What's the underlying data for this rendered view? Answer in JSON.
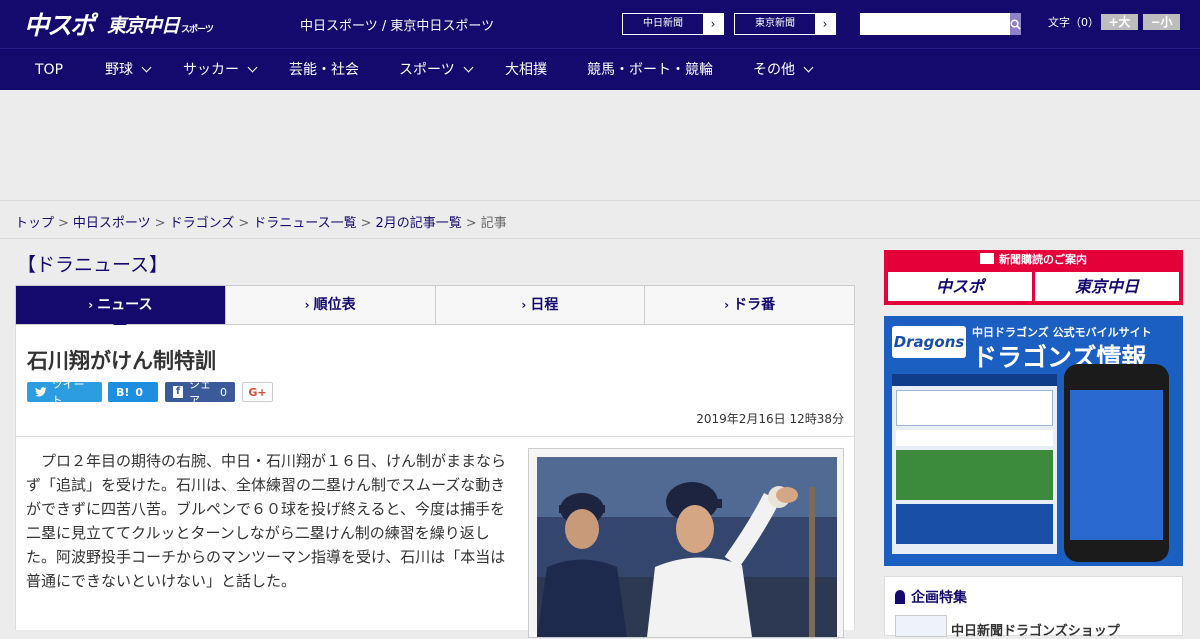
{
  "header": {
    "logo_main": "中スポ",
    "logo_tokyo": "東京中日",
    "logo_tokyo_suffix": "スポーツ",
    "site_title": "中日スポーツ / 東京中日スポーツ",
    "links": [
      {
        "label": "中日新聞"
      },
      {
        "label": "東京新聞"
      }
    ],
    "search_placeholder": "",
    "font_size_label": "文字（0）",
    "font_bigger": "+大",
    "font_smaller": "−小"
  },
  "nav": {
    "items": [
      {
        "label": "TOP",
        "has_menu": false
      },
      {
        "label": "野球",
        "has_menu": true
      },
      {
        "label": "サッカー",
        "has_menu": true
      },
      {
        "label": "芸能・社会",
        "has_menu": false
      },
      {
        "label": "スポーツ",
        "has_menu": true
      },
      {
        "label": "大相撲",
        "has_menu": false
      },
      {
        "label": "競馬・ボート・競輪",
        "has_menu": false
      },
      {
        "label": "その他",
        "has_menu": true
      }
    ]
  },
  "breadcrumb": {
    "items": [
      "トップ",
      "中日スポーツ",
      "ドラゴンズ",
      "ドラニュース一覧",
      "2月の記事一覧"
    ],
    "current": "記事",
    "separator": ">"
  },
  "section": {
    "title": "【ドラニュース】"
  },
  "tabs": [
    {
      "label": "ニュース",
      "active": true
    },
    {
      "label": "順位表",
      "active": false
    },
    {
      "label": "日程",
      "active": false
    },
    {
      "label": "ドラ番",
      "active": false
    }
  ],
  "article": {
    "headline": "石川翔がけん制特訓",
    "share": {
      "tweet": "ツイート",
      "hatena_count": "0",
      "facebook": "シェア",
      "facebook_count": "0",
      "gplus": "G+"
    },
    "date": "2019年2月16日 12時38分",
    "body": "プロ２年目の期待の右腕、中日・石川翔が１６日、けん制がままならず「追試」を受けた。石川は、全体練習の二塁けん制でスムーズな動きができずに四苦八苦。ブルペンで６０球を投げ終えると、今度は捕手を二塁に見立ててクルッとターンしながら二塁けん制の練習を繰り返した。阿波野投手コーチからのマンツーマン指導を受け、石川は「本当は普通にできないといけない」と話した。"
  },
  "sidebar": {
    "subscribe_caption": "新聞購読のご案内",
    "subscribe_logo_1": "中スポ",
    "subscribe_logo_2": "東京中日",
    "banner_brand": "Dragons",
    "banner_line1": "中日ドラゴンズ 公式モバイルサイト",
    "banner_line2": "ドラゴンズ情報",
    "special_title": "企画特集",
    "special_item": "中日新聞ドラゴンズショップ"
  },
  "colors": {
    "brand_navy": "#140a6e",
    "subscribe_red": "#e60039",
    "dragons_blue": "#1a5fc1"
  }
}
